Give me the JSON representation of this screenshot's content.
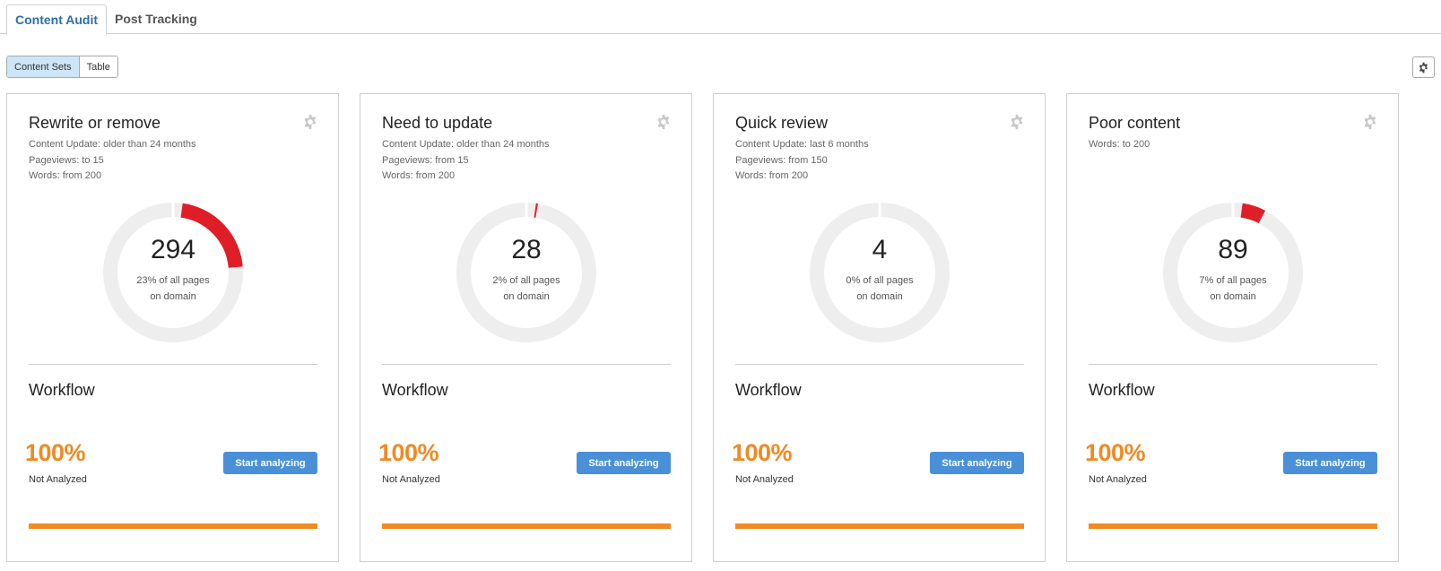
{
  "tabs": [
    {
      "label": "Content Audit",
      "active": true
    },
    {
      "label": "Post Tracking",
      "active": false
    }
  ],
  "view_toggle": {
    "options": [
      "Content Sets",
      "Table"
    ],
    "selected": "Content Sets"
  },
  "icons": {
    "settings": "gear-icon"
  },
  "colors": {
    "accent": "#4a90d9",
    "progress": "#f08a23",
    "donut_fill": "#e01e27",
    "donut_track": "#eeeeee",
    "tab_active": "#2f6ea7"
  },
  "cards": [
    {
      "title": "Rewrite or remove",
      "criteria": [
        "Content Update: older than 24 months",
        "Pageviews: to 15",
        "Words: from 200"
      ],
      "count": "294",
      "share_percent": 23,
      "share_line1": "23% of all pages",
      "share_line2": "on domain",
      "workflow_title": "Workflow",
      "workflow_percent": "100%",
      "workflow_status": "Not Analyzed",
      "workflow_progress": 1.0,
      "button_label": "Start analyzing"
    },
    {
      "title": "Need to update",
      "criteria": [
        "Content Update: older than 24 months",
        "Pageviews: from 15",
        "Words: from 200"
      ],
      "count": "28",
      "share_percent": 2,
      "share_line1": "2% of all pages",
      "share_line2": "on domain",
      "workflow_title": "Workflow",
      "workflow_percent": "100%",
      "workflow_status": "Not Analyzed",
      "workflow_progress": 1.0,
      "button_label": "Start analyzing"
    },
    {
      "title": "Quick review",
      "criteria": [
        "Content Update: last 6 months",
        "Pageviews: from 150",
        "Words: from 200"
      ],
      "count": "4",
      "share_percent": 0,
      "share_line1": "0% of all pages",
      "share_line2": "on domain",
      "workflow_title": "Workflow",
      "workflow_percent": "100%",
      "workflow_status": "Not Analyzed",
      "workflow_progress": 1.0,
      "button_label": "Start analyzing"
    },
    {
      "title": "Poor content",
      "criteria": [
        "Words: to 200"
      ],
      "count": "89",
      "share_percent": 7,
      "share_line1": "7% of all pages",
      "share_line2": "on domain",
      "workflow_title": "Workflow",
      "workflow_percent": "100%",
      "workflow_status": "Not Analyzed",
      "workflow_progress": 1.0,
      "button_label": "Start analyzing"
    }
  ]
}
